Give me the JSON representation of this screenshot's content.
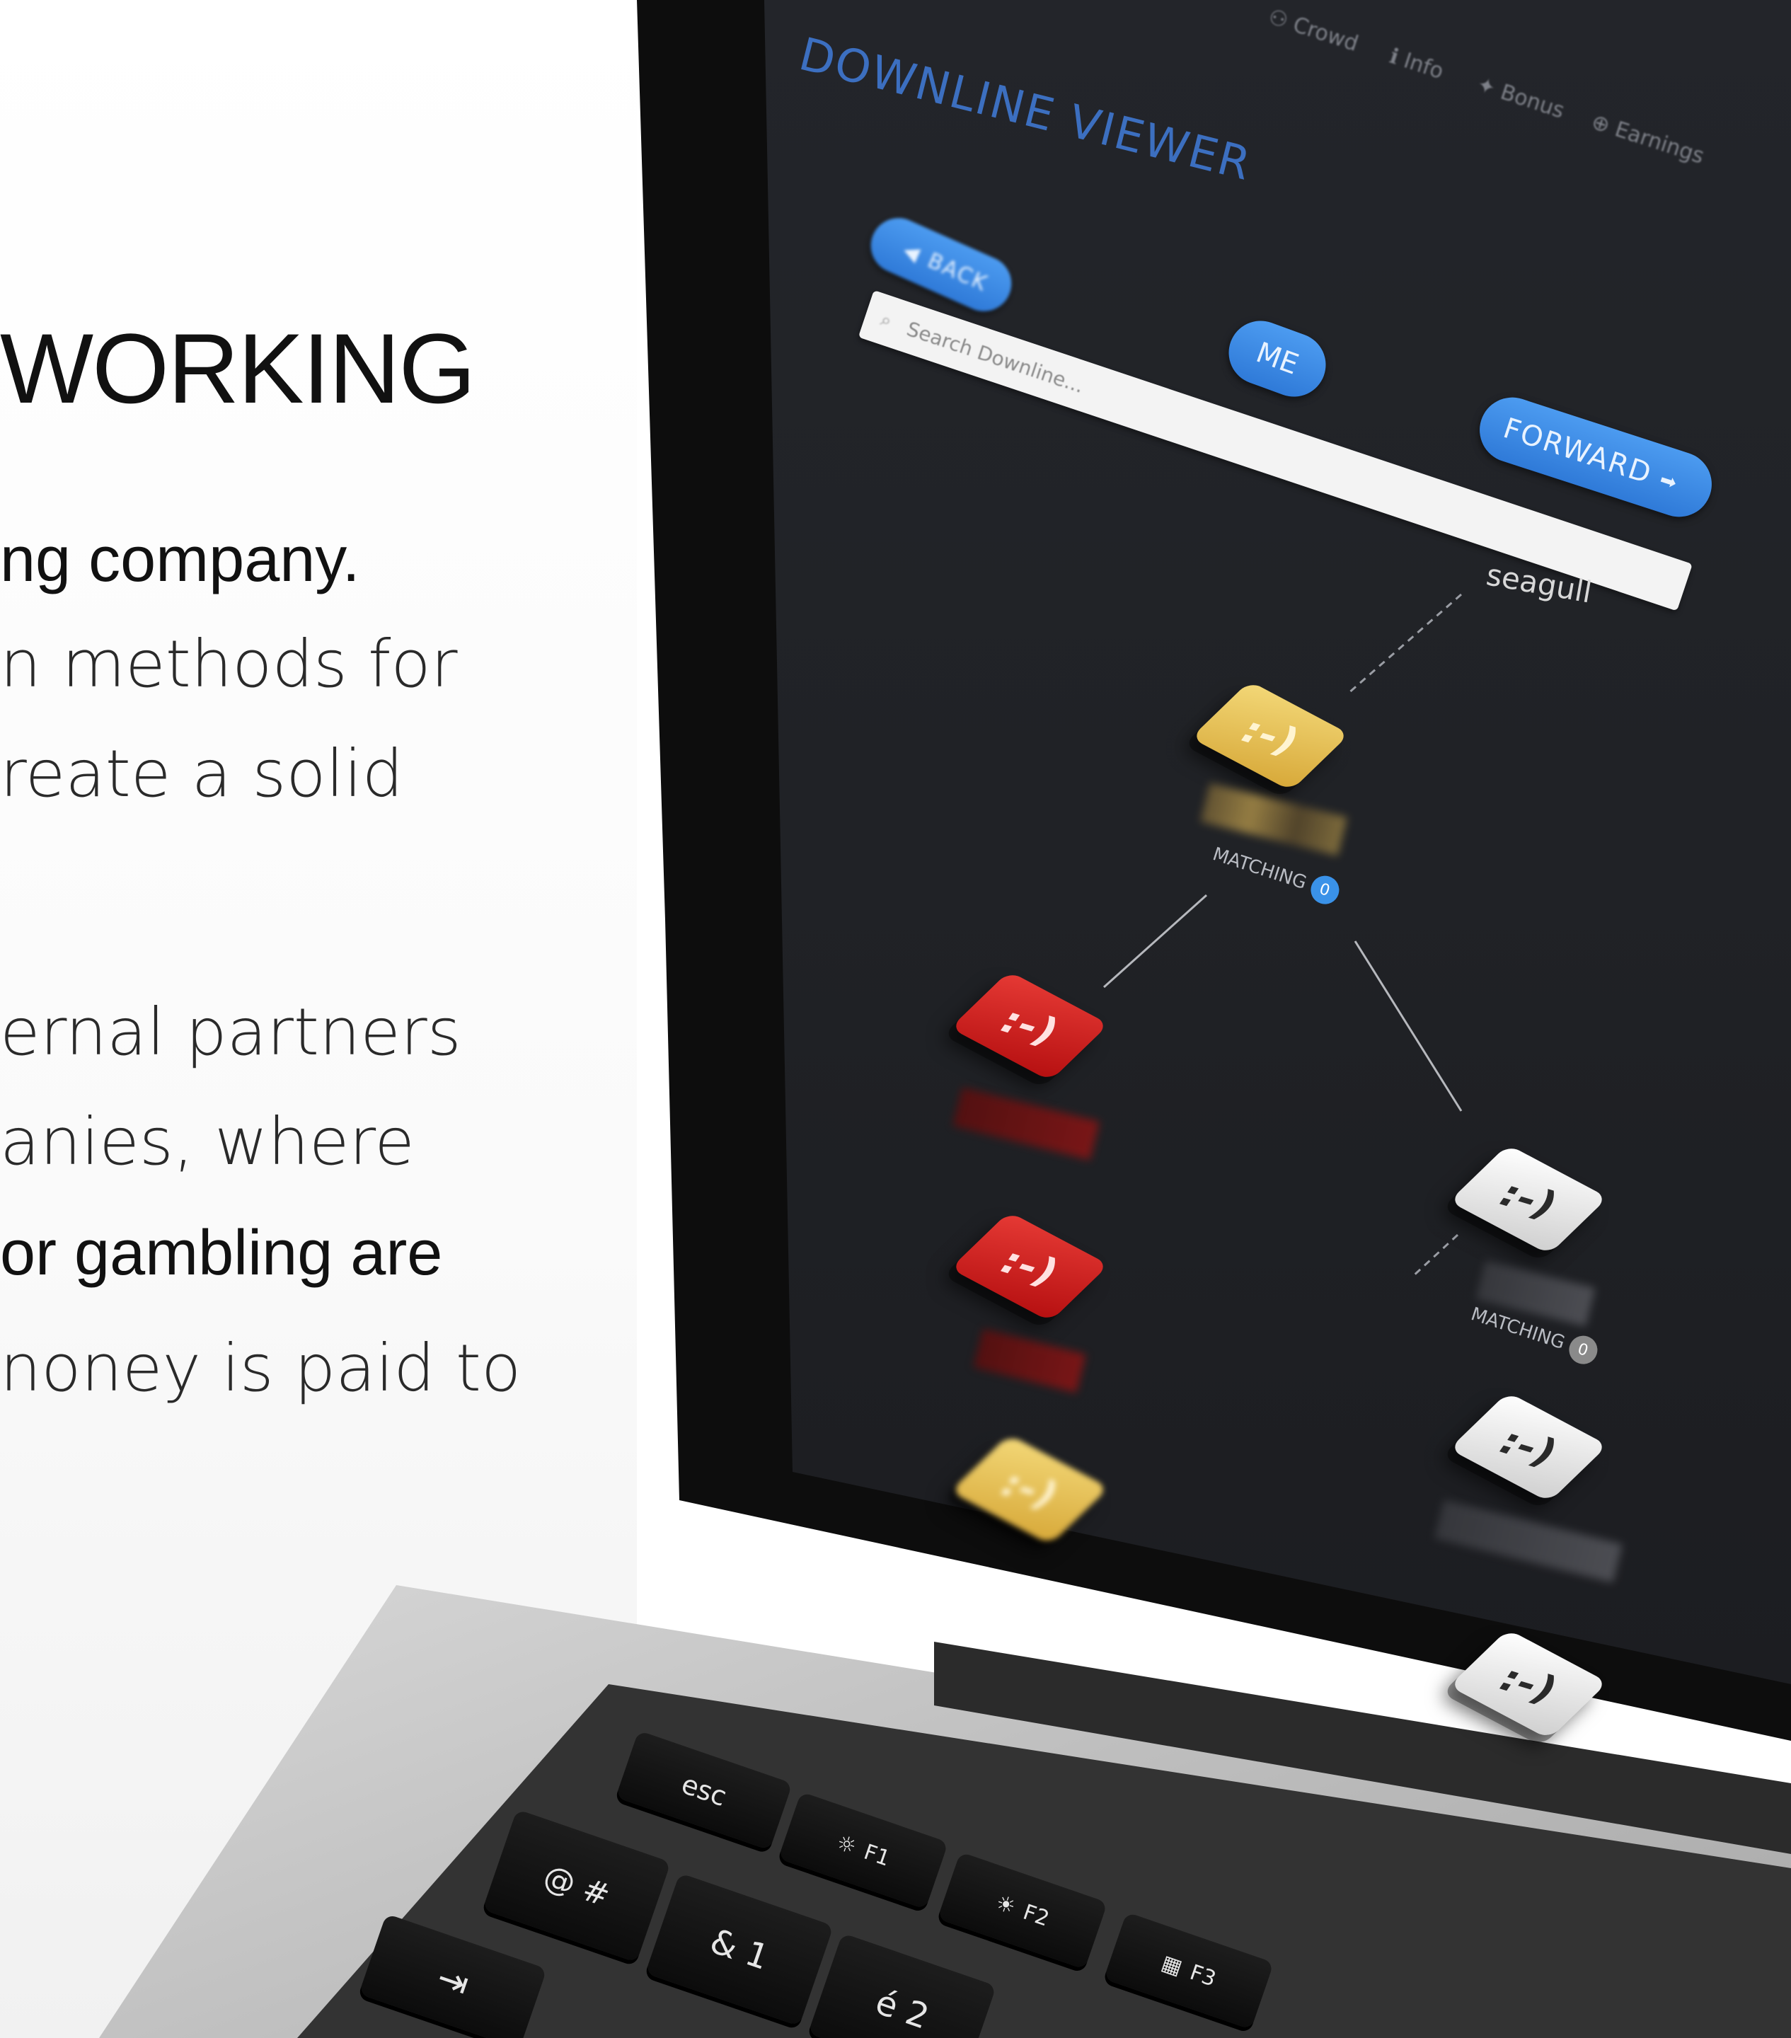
{
  "promo": {
    "heading": "WORKING",
    "lines": [
      "ng company.",
      "n methods for",
      "reate a solid",
      "ernal partners",
      "anies, where",
      "or gambling are",
      "noney is paid to"
    ]
  },
  "app": {
    "nav_items": [
      "Crowd",
      "Info",
      "Bonus",
      "Earnings"
    ],
    "title": "DOWNLINE VIEWER",
    "back_label": "BACK",
    "me_label": "ME",
    "forward_label": "FORWARD",
    "search_placeholder": "Search Downline...",
    "root_user": "seagull",
    "matching_label": "MATCHING",
    "matching_counts": [
      "0",
      "0"
    ]
  },
  "keyboard": {
    "keys": [
      "esc",
      "F1",
      "F2",
      "F3",
      "@",
      "#",
      "&",
      "1",
      "é",
      "2"
    ]
  },
  "colors": {
    "accent": "#3a92e8",
    "screen_bg": "#202226",
    "gold_node": "#e7c255",
    "red_node": "#d42421",
    "white_node": "#eeeeee"
  }
}
